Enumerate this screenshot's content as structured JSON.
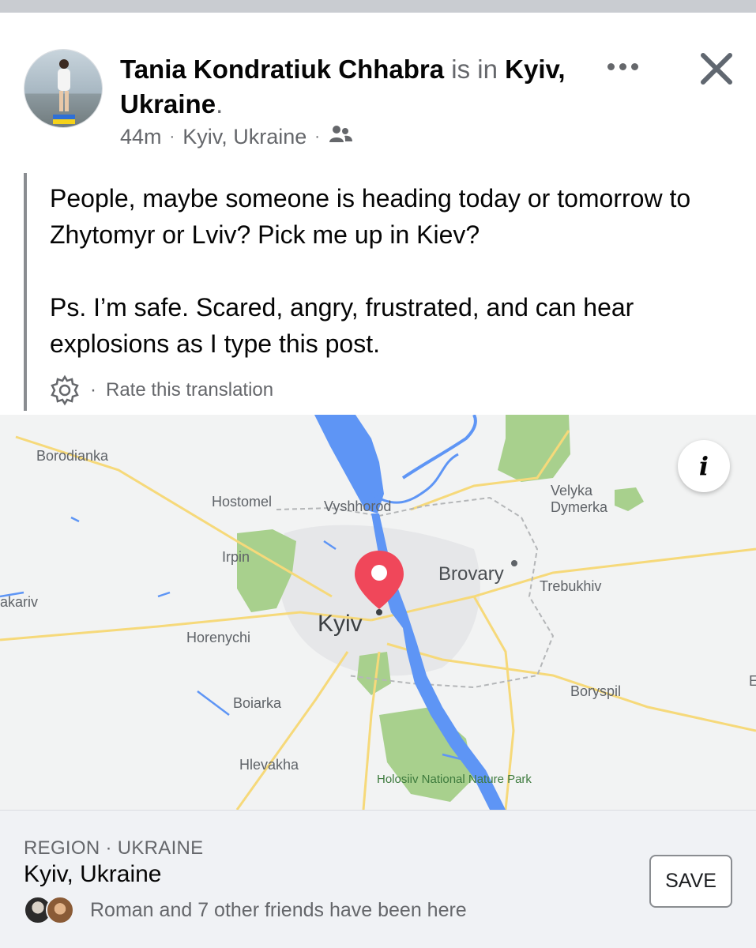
{
  "header": {
    "author": "Tania Kondratiuk Chhabra",
    "is_in": "is in",
    "location": "Kyiv, Ukraine",
    "period": ".",
    "time_ago": "44m",
    "meta_location": "Kyiv, Ukraine",
    "separator": "·",
    "audience_icon": "friends-icon",
    "more_icon": "more-options-icon",
    "close_icon": "close-icon"
  },
  "post": {
    "text": "People, maybe someone is heading today or tomorrow to Zhytomyr or Lviv? Pick me up in Kiev?\n\nPs. I’m safe. Scared, angry, frustrated, and can hear explosions as I type this post.",
    "rate_translation": "Rate this translation"
  },
  "map": {
    "labels": {
      "borodianka": "Borodianka",
      "hostomel": "Hostomel",
      "vyshhorod": "Vyshhorod",
      "velyka_dymerka": "Velyka Dymerka",
      "irpin": "Irpin",
      "brovary": "Brovary",
      "trebukhiv": "Trebukhiv",
      "makariv": "akariv",
      "kyiv": "Kyiv",
      "horenychi": "Horenychi",
      "boryspil": "Boryspil",
      "boiarka": "Boiarka",
      "hlevakha": "Hlevakha",
      "park": "Holosiiv National Nature Park",
      "edge_e": "E"
    },
    "pin_color": "#f0475a",
    "water_color": "#5e95f5",
    "park_color": "#a8d08d",
    "road_color": "#f6d97a",
    "info_label": "i"
  },
  "footer": {
    "region_label": "REGION · UKRAINE",
    "place_name": "Kyiv, Ukraine",
    "friends_text": "Roman and 7 other friends have been here",
    "save_label": "SAVE"
  }
}
